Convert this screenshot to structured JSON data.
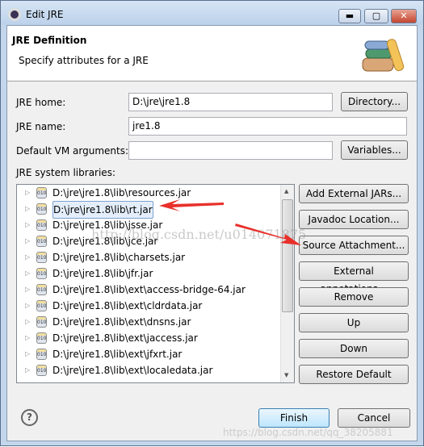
{
  "window": {
    "title": "Edit JRE",
    "minimize": "▬",
    "maximize": "▢",
    "close": "✕"
  },
  "header": {
    "title": "JRE Definition",
    "subtitle": "Specify attributes for a JRE",
    "icon": "books-icon"
  },
  "form": {
    "jre_home_label": "JRE home:",
    "jre_home_value": "D:\\jre\\jre1.8",
    "directory_button": "Directory...",
    "jre_name_label": "JRE name:",
    "jre_name_value": "jre1.8",
    "vm_args_label": "Default VM arguments:",
    "vm_args_value": "",
    "variables_button": "Variables...",
    "libraries_label": "JRE system libraries:"
  },
  "libraries": [
    {
      "path": "D:\\jre\\jre1.8\\lib\\resources.jar"
    },
    {
      "path": "D:\\jre\\jre1.8\\lib\\rt.jar",
      "selected": true
    },
    {
      "path": "D:\\jre\\jre1.8\\lib\\jsse.jar"
    },
    {
      "path": "D:\\jre\\jre1.8\\lib\\jce.jar"
    },
    {
      "path": "D:\\jre\\jre1.8\\lib\\charsets.jar"
    },
    {
      "path": "D:\\jre\\jre1.8\\lib\\jfr.jar"
    },
    {
      "path": "D:\\jre\\jre1.8\\lib\\ext\\access-bridge-64.jar"
    },
    {
      "path": "D:\\jre\\jre1.8\\lib\\ext\\cldrdata.jar"
    },
    {
      "path": "D:\\jre\\jre1.8\\lib\\ext\\dnsns.jar"
    },
    {
      "path": "D:\\jre\\jre1.8\\lib\\ext\\jaccess.jar"
    },
    {
      "path": "D:\\jre\\jre1.8\\lib\\ext\\jfxrt.jar"
    },
    {
      "path": "D:\\jre\\jre1.8\\lib\\ext\\localedata.jar"
    }
  ],
  "side_buttons": [
    "Add External JARs...",
    "Javadoc Location...",
    "Source Attachment...",
    "External annotations...",
    "Remove",
    "Up",
    "Down",
    "Restore Default"
  ],
  "footer": {
    "help": "?",
    "finish": "Finish",
    "cancel": "Cancel"
  },
  "watermarks": [
    "http://blog.csdn.net/u014071875",
    "https://blog.csdn.net/qq_38205881"
  ],
  "colors": {
    "annotation_arrow": "#e8302a"
  }
}
